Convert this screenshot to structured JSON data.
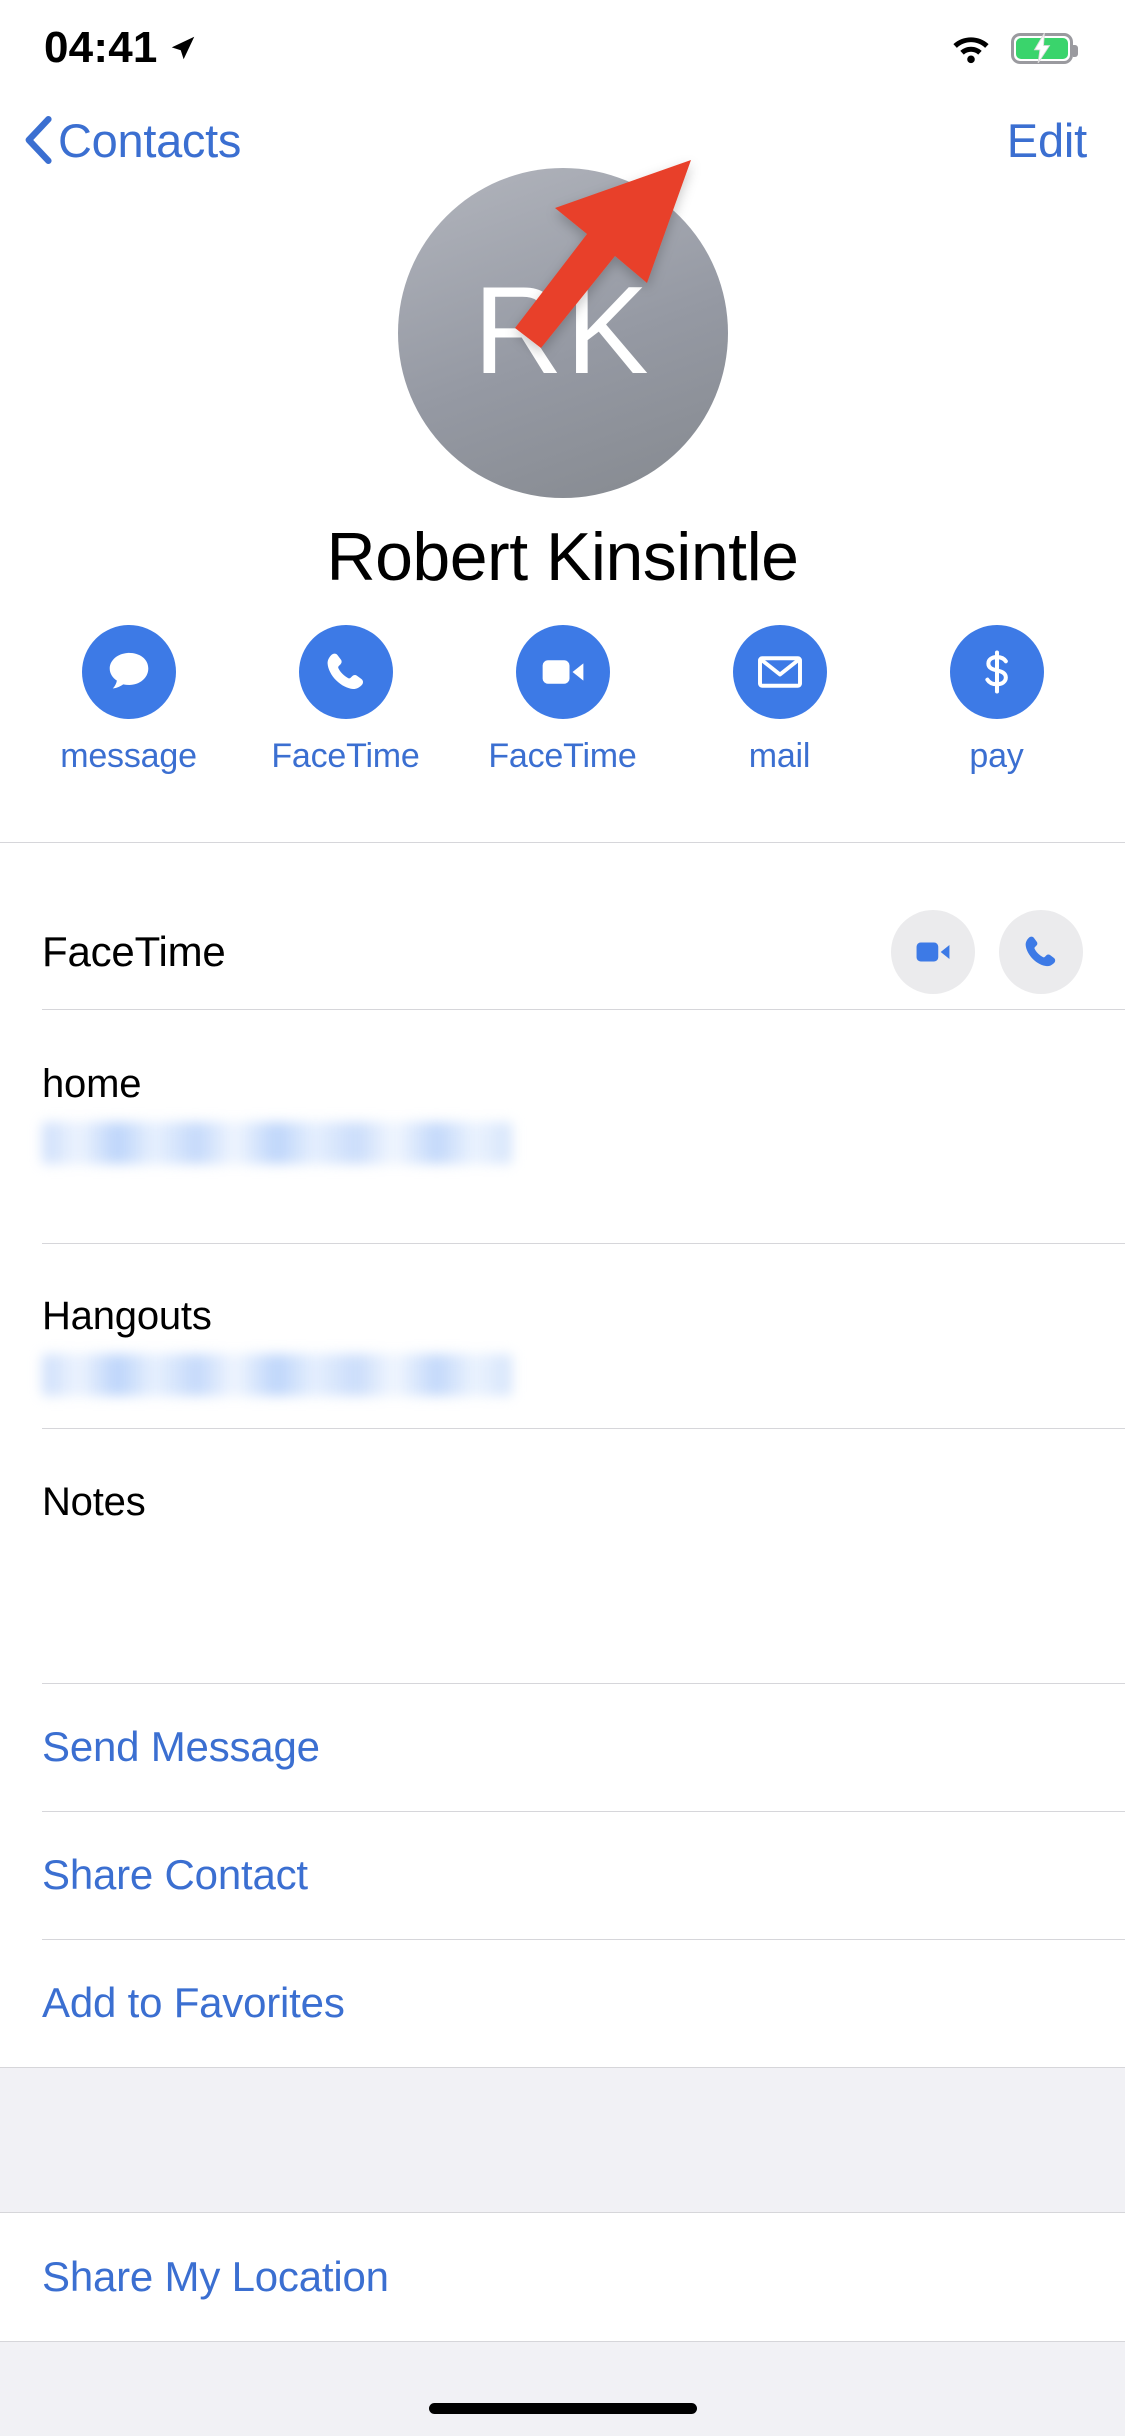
{
  "status_bar": {
    "time": "04:41",
    "location_icon": "location-arrow-icon",
    "wifi_icon": "wifi-icon",
    "battery_icon": "battery-charging-icon",
    "battery_color": "#3ad46c"
  },
  "nav_bar": {
    "back_label": "Contacts",
    "back_icon": "chevron-left-icon",
    "edit_label": "Edit",
    "tint_color": "#3b6fd1"
  },
  "contact": {
    "initials": "RK",
    "name": "Robert Kinsintle",
    "avatar_color": "#9599a3"
  },
  "quick_actions": [
    {
      "label": "message",
      "icon": "message-bubble-icon"
    },
    {
      "label": "FaceTime",
      "icon": "phone-icon"
    },
    {
      "label": "FaceTime",
      "icon": "video-camera-icon"
    },
    {
      "label": "mail",
      "icon": "envelope-icon"
    },
    {
      "label": "pay",
      "icon": "dollar-sign-icon"
    }
  ],
  "details": {
    "facetime": {
      "title": "FaceTime",
      "video_icon": "video-camera-icon",
      "audio_icon": "phone-icon"
    },
    "fields": [
      {
        "label": "home",
        "value": "",
        "redacted": true
      },
      {
        "label": "Hangouts",
        "value": "",
        "redacted": true
      }
    ],
    "notes": {
      "label": "Notes",
      "value": ""
    }
  },
  "action_links": [
    {
      "label": "Send Message"
    },
    {
      "label": "Share Contact"
    },
    {
      "label": "Add to Favorites"
    }
  ],
  "footer_links": [
    {
      "label": "Share My Location"
    }
  ],
  "annotation": {
    "type": "arrow",
    "color": "#e8402a",
    "points_to": "Edit"
  }
}
